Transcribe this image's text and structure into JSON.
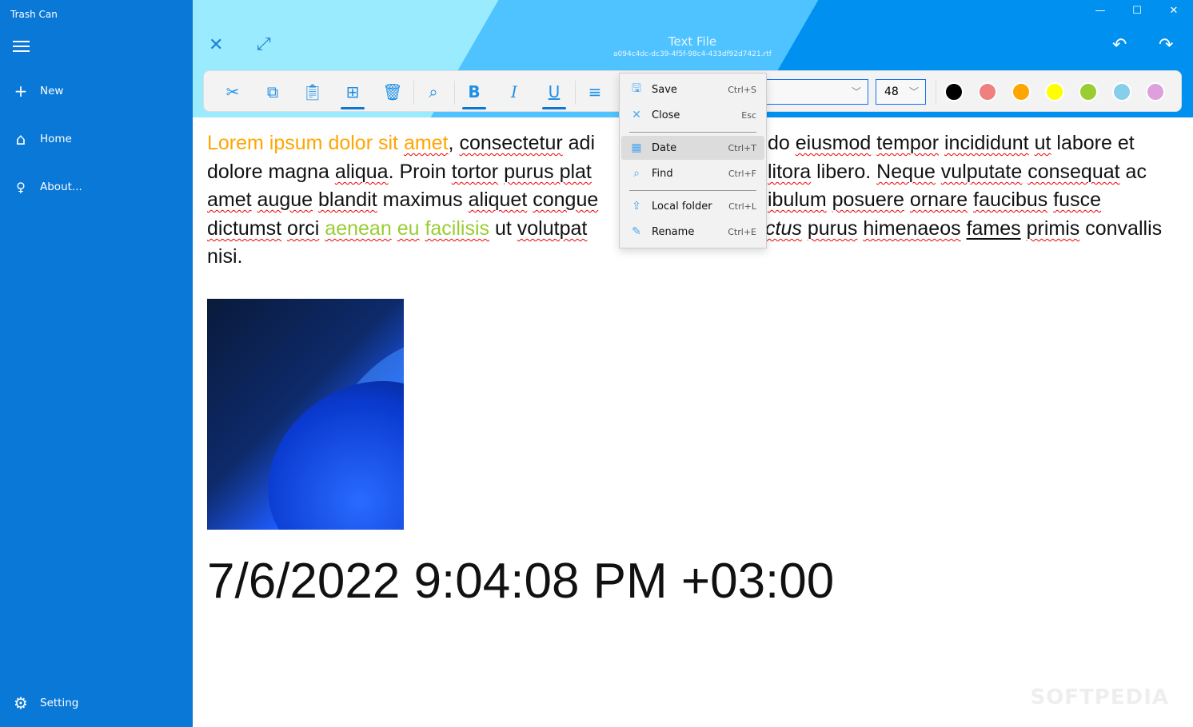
{
  "app": {
    "title": "Trash Can"
  },
  "sidebar": {
    "items": [
      {
        "label": "New",
        "icon": "plus-icon"
      },
      {
        "label": "Home",
        "icon": "home-icon"
      },
      {
        "label": "About...",
        "icon": "lightbulb-icon"
      }
    ],
    "setting": "Setting"
  },
  "header": {
    "title": "Text File",
    "filename": "a094c4dc-dc39-4f5f-98c4-433df92d7421.rtf"
  },
  "toolbar": {
    "font_size": "48",
    "font_family": "",
    "colors": [
      "#000000",
      "#F08080",
      "#FFA500",
      "#FFFF00",
      "#9ACD32",
      "#87CEEB",
      "#DDA0DD"
    ]
  },
  "menu": {
    "items": [
      {
        "label": "Save",
        "shortcut": "Ctrl+S"
      },
      {
        "label": "Close",
        "shortcut": "Esc"
      },
      {
        "label": "Date",
        "shortcut": "Ctrl+T"
      },
      {
        "label": "Find",
        "shortcut": "Ctrl+F"
      },
      {
        "label": "Local folder",
        "shortcut": "Ctrl+L"
      },
      {
        "label": "Rename",
        "shortcut": "Ctrl+E"
      }
    ]
  },
  "doc": {
    "l1a": "Lorem ipsum dolor sit ",
    "l1b": "amet",
    ", ": "",
    "l1c": ", ",
    "l1d": "consectetur",
    "l1e": " adi",
    "l1f": " do ",
    "l1g": "eiusmod",
    "l1h": " ",
    "l1i": "tempor",
    "l1j": " ",
    "l1k": "incididunt",
    "l1l": " ",
    "l1m": "ut",
    "l1n": " labore et",
    "l2a": "dolore magna ",
    "l2b": "aliqua",
    ". Proin ": "",
    "l2c": ". Proin ",
    "l2d": "tortor",
    "l2e": " ",
    "l2f": "purus",
    "l2g": " plat",
    "l2h": "litora",
    "l2i": " libero. ",
    "l2j": "Neque",
    "l2k": " ",
    "l2l": "vulputate",
    "l2m": " ",
    "l2n": "consequat",
    "l2o": " ac",
    "l3a": "amet",
    "l3b": " ",
    "l3c": "augue",
    "l3d": " ",
    "l3e": "blandit",
    "l3f": " maximus ",
    "l3g": "aliquet",
    "l3h": " ",
    "l3i": "congue",
    "l3j": "ibulum",
    "l3k": " ",
    "l3l": "posuere",
    "l3m": " ",
    "l3n": "ornare",
    "l3o": " ",
    "l3p": "faucibus",
    "l3q": " ",
    "l3r": "fusce",
    "l4a": "dictumst",
    "l4b": " ",
    "l4c": "orci",
    "l4d": " ",
    "l4e": "aenean",
    "l4f": " ",
    "l4g": "eu",
    "l4h": " ",
    "l4i": "facilisis",
    "l4j": " ut ",
    "l4k": "volutpat",
    "l4l": "ctus",
    "l4m": " ",
    "l4n": "purus",
    "l4o": " ",
    "l4p": "himenaeos",
    "l4q": " ",
    "l4r": "fames",
    "l4s": " ",
    "l4t": "primis",
    "l4u": " convallis",
    "l5": "nisi.",
    "date": "7/6/2022 9:04:08 PM +03:00"
  },
  "watermark": "SOFTPEDIA"
}
